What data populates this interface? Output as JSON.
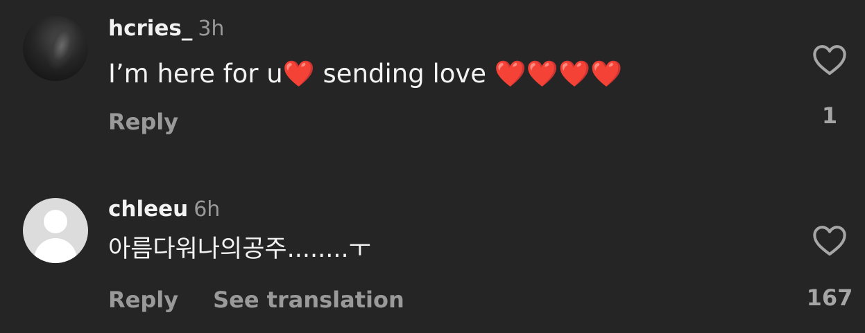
{
  "comments": [
    {
      "username": "hcries_",
      "time": "3h",
      "text": "I’m here for u❤️ sending love ❤️❤️❤️❤️",
      "actions": [
        "Reply"
      ],
      "likes": "1",
      "avatar": "profile-photo"
    },
    {
      "username": "chleeu",
      "time": "6h",
      "text": "아름다워나의공주........ㅜ",
      "actions": [
        "Reply",
        "See translation"
      ],
      "likes": "167",
      "avatar": "default-avatar"
    }
  ],
  "icons": {
    "like": "heart-outline-icon"
  },
  "colors": {
    "background": "#252525",
    "username": "#f2f2f2",
    "secondary_text": "#9a9a9a",
    "heart_outline": "#a6a6a6"
  }
}
